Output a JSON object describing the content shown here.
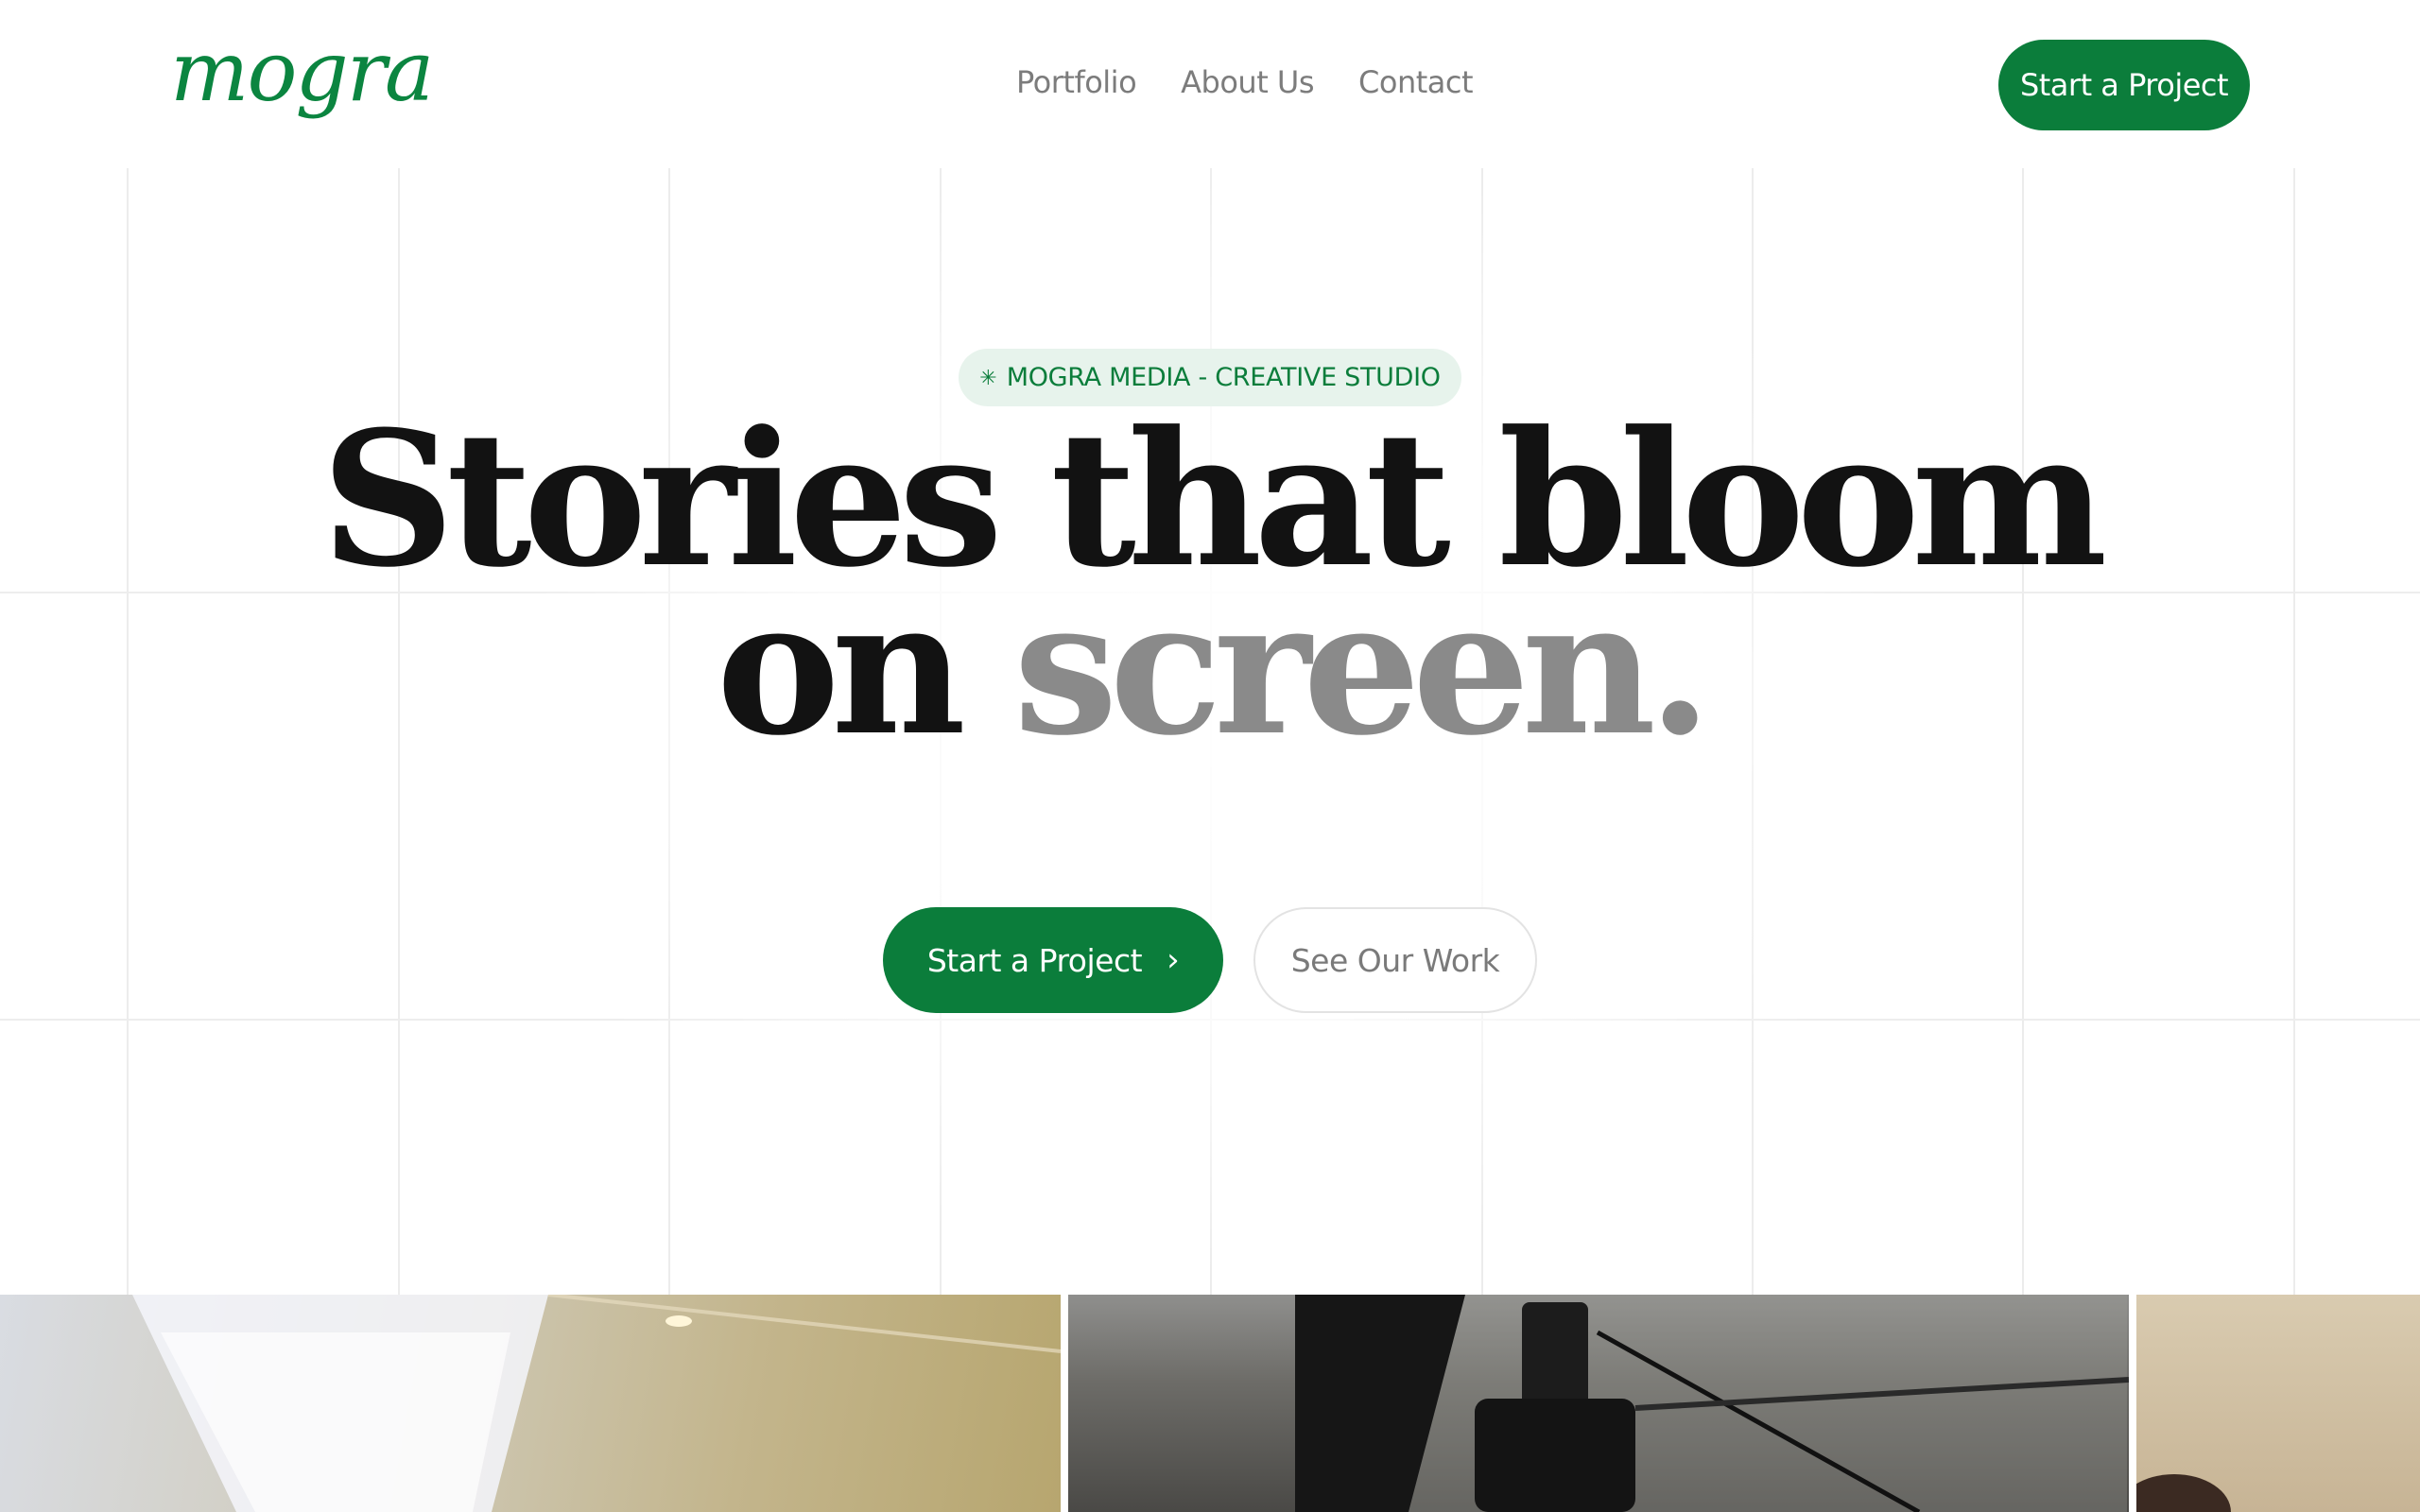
{
  "header": {
    "logo_text": "mogra",
    "nav": [
      {
        "label": "Portfolio"
      },
      {
        "label": "About Us"
      },
      {
        "label": "Contact"
      }
    ],
    "cta_label": "Start a Project"
  },
  "hero": {
    "badge_icon": "sparkle-icon",
    "badge_text": "MOGRA MEDIA - CREATIVE STUDIO",
    "headline_line1": "Stories that bloom",
    "headline_line2_dark": "on",
    "headline_line2_muted": "screen.",
    "primary_cta": "Start a Project",
    "primary_cta_icon": "chevron-right-icon",
    "secondary_cta": "See Our Work"
  },
  "colors": {
    "brand_green": "#0b7d3b",
    "badge_bg": "#e7f3ec",
    "muted_text": "#8a8a8a",
    "ink": "#121212"
  },
  "media_strip": {
    "items": [
      {
        "name": "studio-lighting-photo"
      },
      {
        "name": "camera-rig-photo"
      },
      {
        "name": "portrait-photo"
      }
    ]
  }
}
